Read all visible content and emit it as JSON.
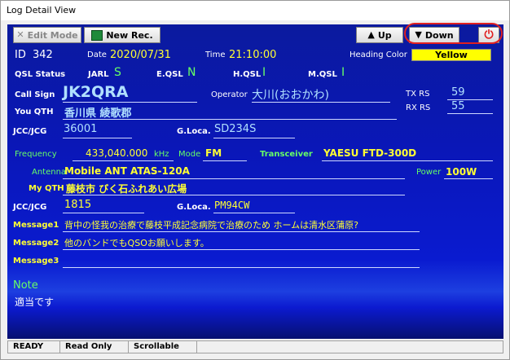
{
  "window": {
    "title": "Log Detail View"
  },
  "toolbar": {
    "edit_mode": "Edit Mode",
    "new_rec": "New Rec.",
    "up": "Up",
    "down": "Down"
  },
  "header": {
    "id_label": "ID",
    "id_value": "342",
    "date_label": "Date",
    "date_value": "2020/07/31",
    "time_label": "Time",
    "time_value": "21:10:00",
    "heading_color_label": "Heading Color",
    "heading_color_value": "Yellow",
    "heading_color_hex": "#ffff00"
  },
  "qsl": {
    "status_label": "QSL Status",
    "jarl_label": "JARL",
    "jarl_value": "S",
    "eqsl_label": "E.QSL",
    "eqsl_value": "N",
    "hqsl_label": "H.QSL",
    "hqsl_value": "I",
    "mqsl_label": "M.QSL",
    "mqsl_value": "I"
  },
  "contact": {
    "callsign_label": "Call Sign",
    "callsign_value": "JK2QRA",
    "operator_label": "Operator",
    "operator_value": "大川(おおかわ)",
    "txrs_label": "TX RS",
    "txrs_value": "59",
    "rxrs_label": "RX RS",
    "rxrs_value": "55",
    "your_qth_label": "You QTH",
    "your_qth_value": "香川県 綾歌郡",
    "jcc_label": "JCC/JCG",
    "jcc_value": "36001",
    "gloca_label": "G.Loca.",
    "gloca_value": "SD234S"
  },
  "station": {
    "frequency_label": "Frequency",
    "frequency_value": "433,040.000",
    "frequency_unit": "kHz",
    "mode_label": "Mode",
    "mode_value": "FM",
    "transceiver_label": "Transceiver",
    "transceiver_value": "YAESU FTD-300D",
    "antenna_label": "Antenna",
    "antenna_value": "Mobile ANT ATAS-120A",
    "power_label": "Power",
    "power_value": "100W",
    "my_qth_label": "My QTH",
    "my_qth_value": "藤枝市 びく石ふれあい広場",
    "my_jcc_label": "JCC/JCG",
    "my_jcc_value": "1815",
    "my_gloca_label": "G.Loca.",
    "my_gloca_value": "PM94CW"
  },
  "messages": {
    "m1_label": "Message1",
    "m1_value": "背中の怪我の治療で藤枝平成記念病院で治療のため ホームは清水区蒲原?",
    "m2_label": "Message2",
    "m2_value": "他のバンドでもQSOお願いします。",
    "m3_label": "Message3",
    "m3_value": ""
  },
  "note": {
    "label": "Note",
    "value": "適当です"
  },
  "statusbar": {
    "ready": "READY",
    "read_only": "Read Only",
    "scrollable": "Scrollable"
  }
}
